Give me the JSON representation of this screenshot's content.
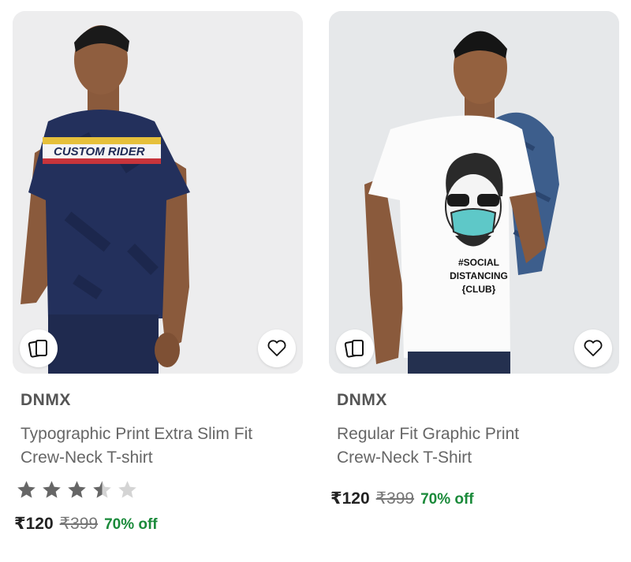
{
  "products": [
    {
      "brand": "DNMX",
      "title_line1": "Typographic Print Extra Slim Fit",
      "title_line2": "Crew-Neck T-shirt",
      "rating": 3.5,
      "price": "₹120",
      "mrp": "₹399",
      "discount": "70% off",
      "tshirt_text": "CUSTOM RIDER"
    },
    {
      "brand": "DNMX",
      "title_line1": "Regular Fit Graphic Print",
      "title_line2": "Crew-Neck T-Shirt",
      "price": "₹120",
      "mrp": "₹399",
      "discount": "70% off",
      "tshirt_text_line1": "#SOCIAL",
      "tshirt_text_line2": "DISTANCING",
      "tshirt_text_line3": "{CLUB}"
    }
  ],
  "icons": {
    "compare": "compare-cards-icon",
    "wishlist": "heart-icon",
    "star": "star-icon"
  },
  "colors": {
    "discount": "#1a8a3a",
    "star_filled": "#666666",
    "star_empty": "#d4d4d4",
    "card_bg": "#e9e9ea"
  }
}
